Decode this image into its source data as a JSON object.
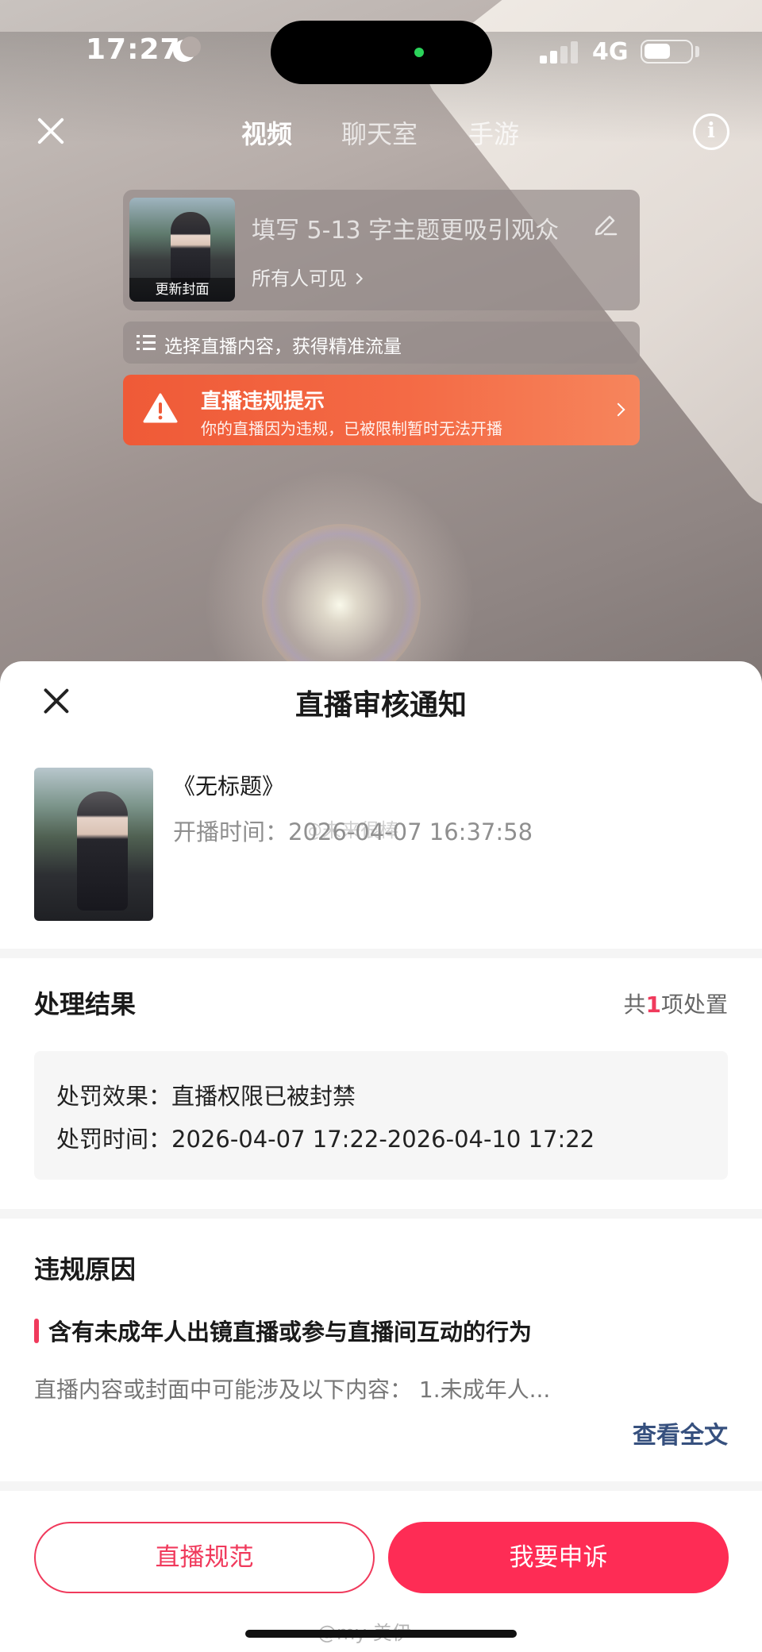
{
  "status_bar": {
    "time": "17:27",
    "network": "4G",
    "icons": [
      "moon-icon",
      "signal-icon",
      "battery-icon"
    ]
  },
  "top_bar": {
    "tabs": [
      {
        "label": "视频",
        "active": true
      },
      {
        "label": "聊天室",
        "active": false
      },
      {
        "label": "手游",
        "active": false
      }
    ],
    "close_icon": "close-icon",
    "info_icon": "info-icon",
    "info_glyph": "i"
  },
  "title_card": {
    "cover_label": "更新封面",
    "title_placeholder": "填写 5-13 字主题更吸引观众",
    "visibility": "所有人可见"
  },
  "content_select": {
    "text": "选择直播内容，获得精准流量"
  },
  "violation_banner": {
    "title": "直播违规提示",
    "subtitle": "你的直播因为违规，已被限制暂时无法开播"
  },
  "sheet": {
    "title": "直播审核通知",
    "stream": {
      "title": "《无标题》",
      "start_time_label": "开播时间：",
      "start_time": "2026-04-07 16:37:58"
    },
    "result": {
      "section_title": "处理结果",
      "count_prefix": "共",
      "count": "1",
      "count_suffix": "项处置",
      "effect_label": "处罚效果：",
      "effect_value": "直播权限已被封禁",
      "time_label": "处罚时间：",
      "time_value": "2026-04-07 17:22-2026-04-10 17:22"
    },
    "reason": {
      "section_title": "违规原因",
      "headline": "含有未成年人出镜直播或参与直播间互动的行为",
      "description": "直播内容或封面中可能涉及以下内容： 1.未成年人...",
      "view_all": "查看全文"
    },
    "buttons": {
      "guidelines": "直播规范",
      "appeal": "我要申诉"
    }
  },
  "watermarks": {
    "mid": "@未来很棒",
    "bottom": "@my-美伊"
  },
  "colors": {
    "accent": "#fe2c55",
    "warning": "#ef5a37",
    "link": "#36507e"
  }
}
